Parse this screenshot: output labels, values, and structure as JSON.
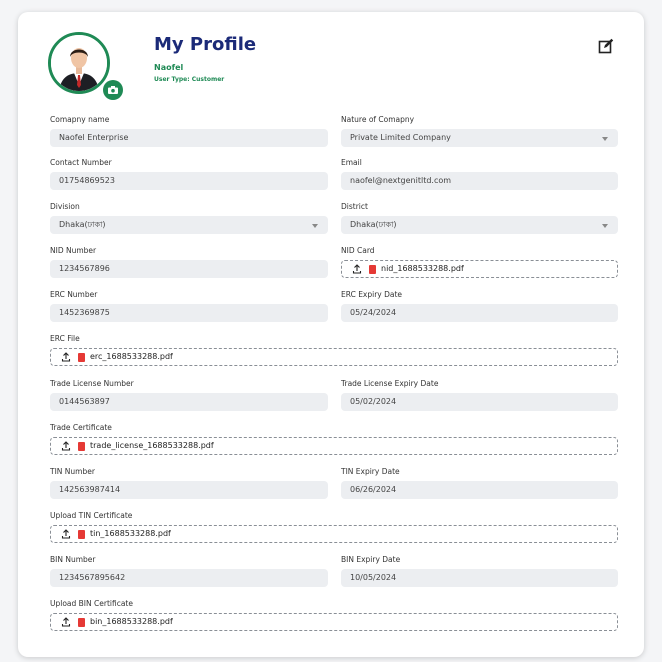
{
  "profile": {
    "title": "My Profile",
    "name": "Naofel",
    "user_type": "User Type: Customer"
  },
  "fields": {
    "company_name": {
      "label": "Comapny name",
      "value": "Naofel Enterprise"
    },
    "nature": {
      "label": "Nature of Comapny",
      "value": "Private Limited Company"
    },
    "contact": {
      "label": "Contact Number",
      "value": "01754869523"
    },
    "email": {
      "label": "Email",
      "value": "naofel@nextgenitltd.com"
    },
    "division": {
      "label": "Division",
      "value": "Dhaka(ঢাকা)"
    },
    "district": {
      "label": "District",
      "value": "Dhaka(ঢাকা)"
    },
    "nid_number": {
      "label": "NID Number",
      "value": "1234567896"
    },
    "nid_card": {
      "label": "NID Card",
      "value": "nid_1688533288.pdf"
    },
    "erc_number": {
      "label": "ERC Number",
      "value": "1452369875"
    },
    "erc_expiry": {
      "label": "ERC Expiry Date",
      "value": "05/24/2024"
    },
    "erc_file": {
      "label": "ERC File",
      "value": "erc_1688533288.pdf"
    },
    "trade_number": {
      "label": "Trade License Number",
      "value": "0144563897"
    },
    "trade_expiry": {
      "label": "Trade License Expiry Date",
      "value": "05/02/2024"
    },
    "trade_cert": {
      "label": "Trade Certificate",
      "value": "trade_license_1688533288.pdf"
    },
    "tin_number": {
      "label": "TIN Number",
      "value": "142563987414"
    },
    "tin_expiry": {
      "label": "TIN Expiry Date",
      "value": "06/26/2024"
    },
    "tin_cert": {
      "label": "Upload TIN Certificate",
      "value": "tin_1688533288.pdf"
    },
    "bin_number": {
      "label": "BIN Number",
      "value": "1234567895642"
    },
    "bin_expiry": {
      "label": "BIN Expiry Date",
      "value": "10/05/2024"
    },
    "bin_cert": {
      "label": "Upload BIN Certificate",
      "value": "bin_1688533288.pdf"
    }
  },
  "icons": {
    "edit": "edit-icon",
    "camera": "camera-icon",
    "upload": "upload-icon",
    "pdf": "pdf-icon",
    "dropdown": "chevron-down-icon"
  },
  "colors": {
    "accent_green": "#1f8a55",
    "title_navy": "#1b2a78",
    "pdf_red": "#e53935",
    "field_bg": "#eceef1"
  }
}
